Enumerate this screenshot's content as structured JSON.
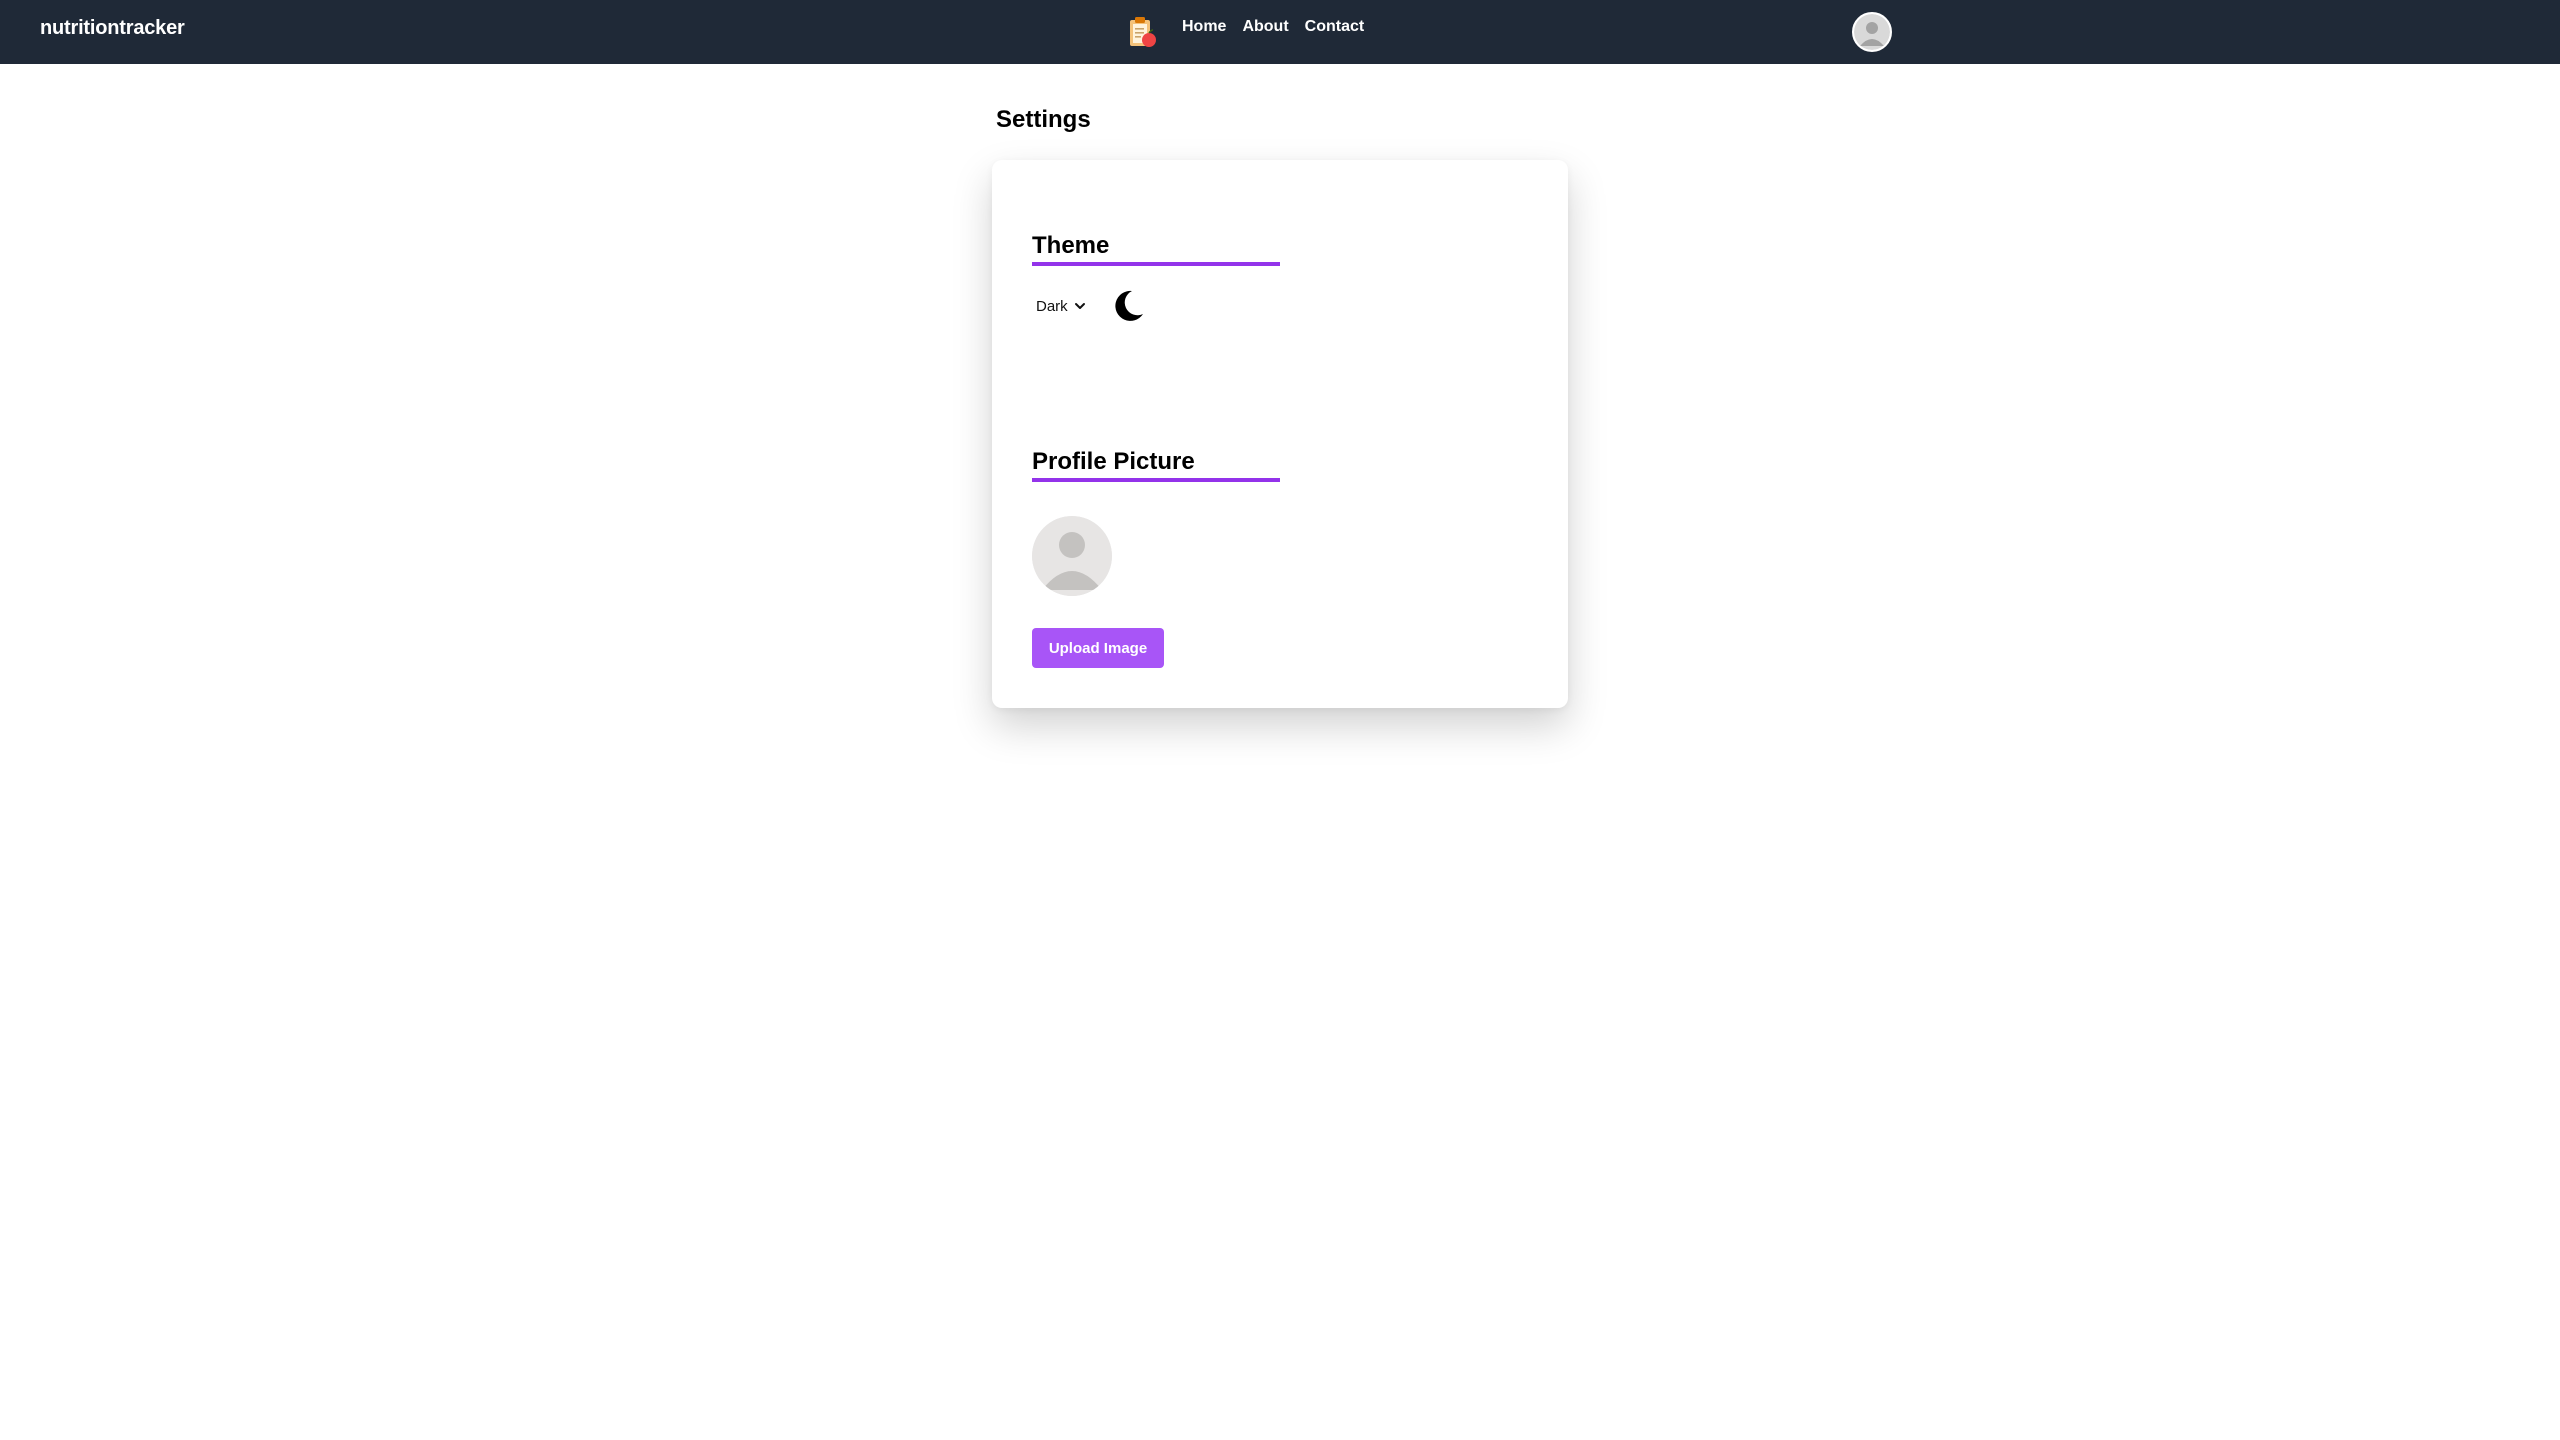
{
  "header": {
    "brand": "nutritiontracker",
    "logo_icon": "clipboard-apple-icon",
    "nav": [
      {
        "label": "Home"
      },
      {
        "label": "About"
      },
      {
        "label": "Contact"
      }
    ],
    "avatar_icon": "user-avatar-icon"
  },
  "page": {
    "title": "Settings"
  },
  "settings": {
    "theme": {
      "heading": "Theme",
      "selected": "Dark",
      "icon": "moon-icon"
    },
    "profile": {
      "heading": "Profile Picture",
      "avatar_icon": "default-avatar-icon",
      "upload_label": "Upload Image"
    }
  },
  "colors": {
    "navbar_bg": "#1f2937",
    "accent": "#9333ea",
    "button_bg": "#a855f7"
  }
}
